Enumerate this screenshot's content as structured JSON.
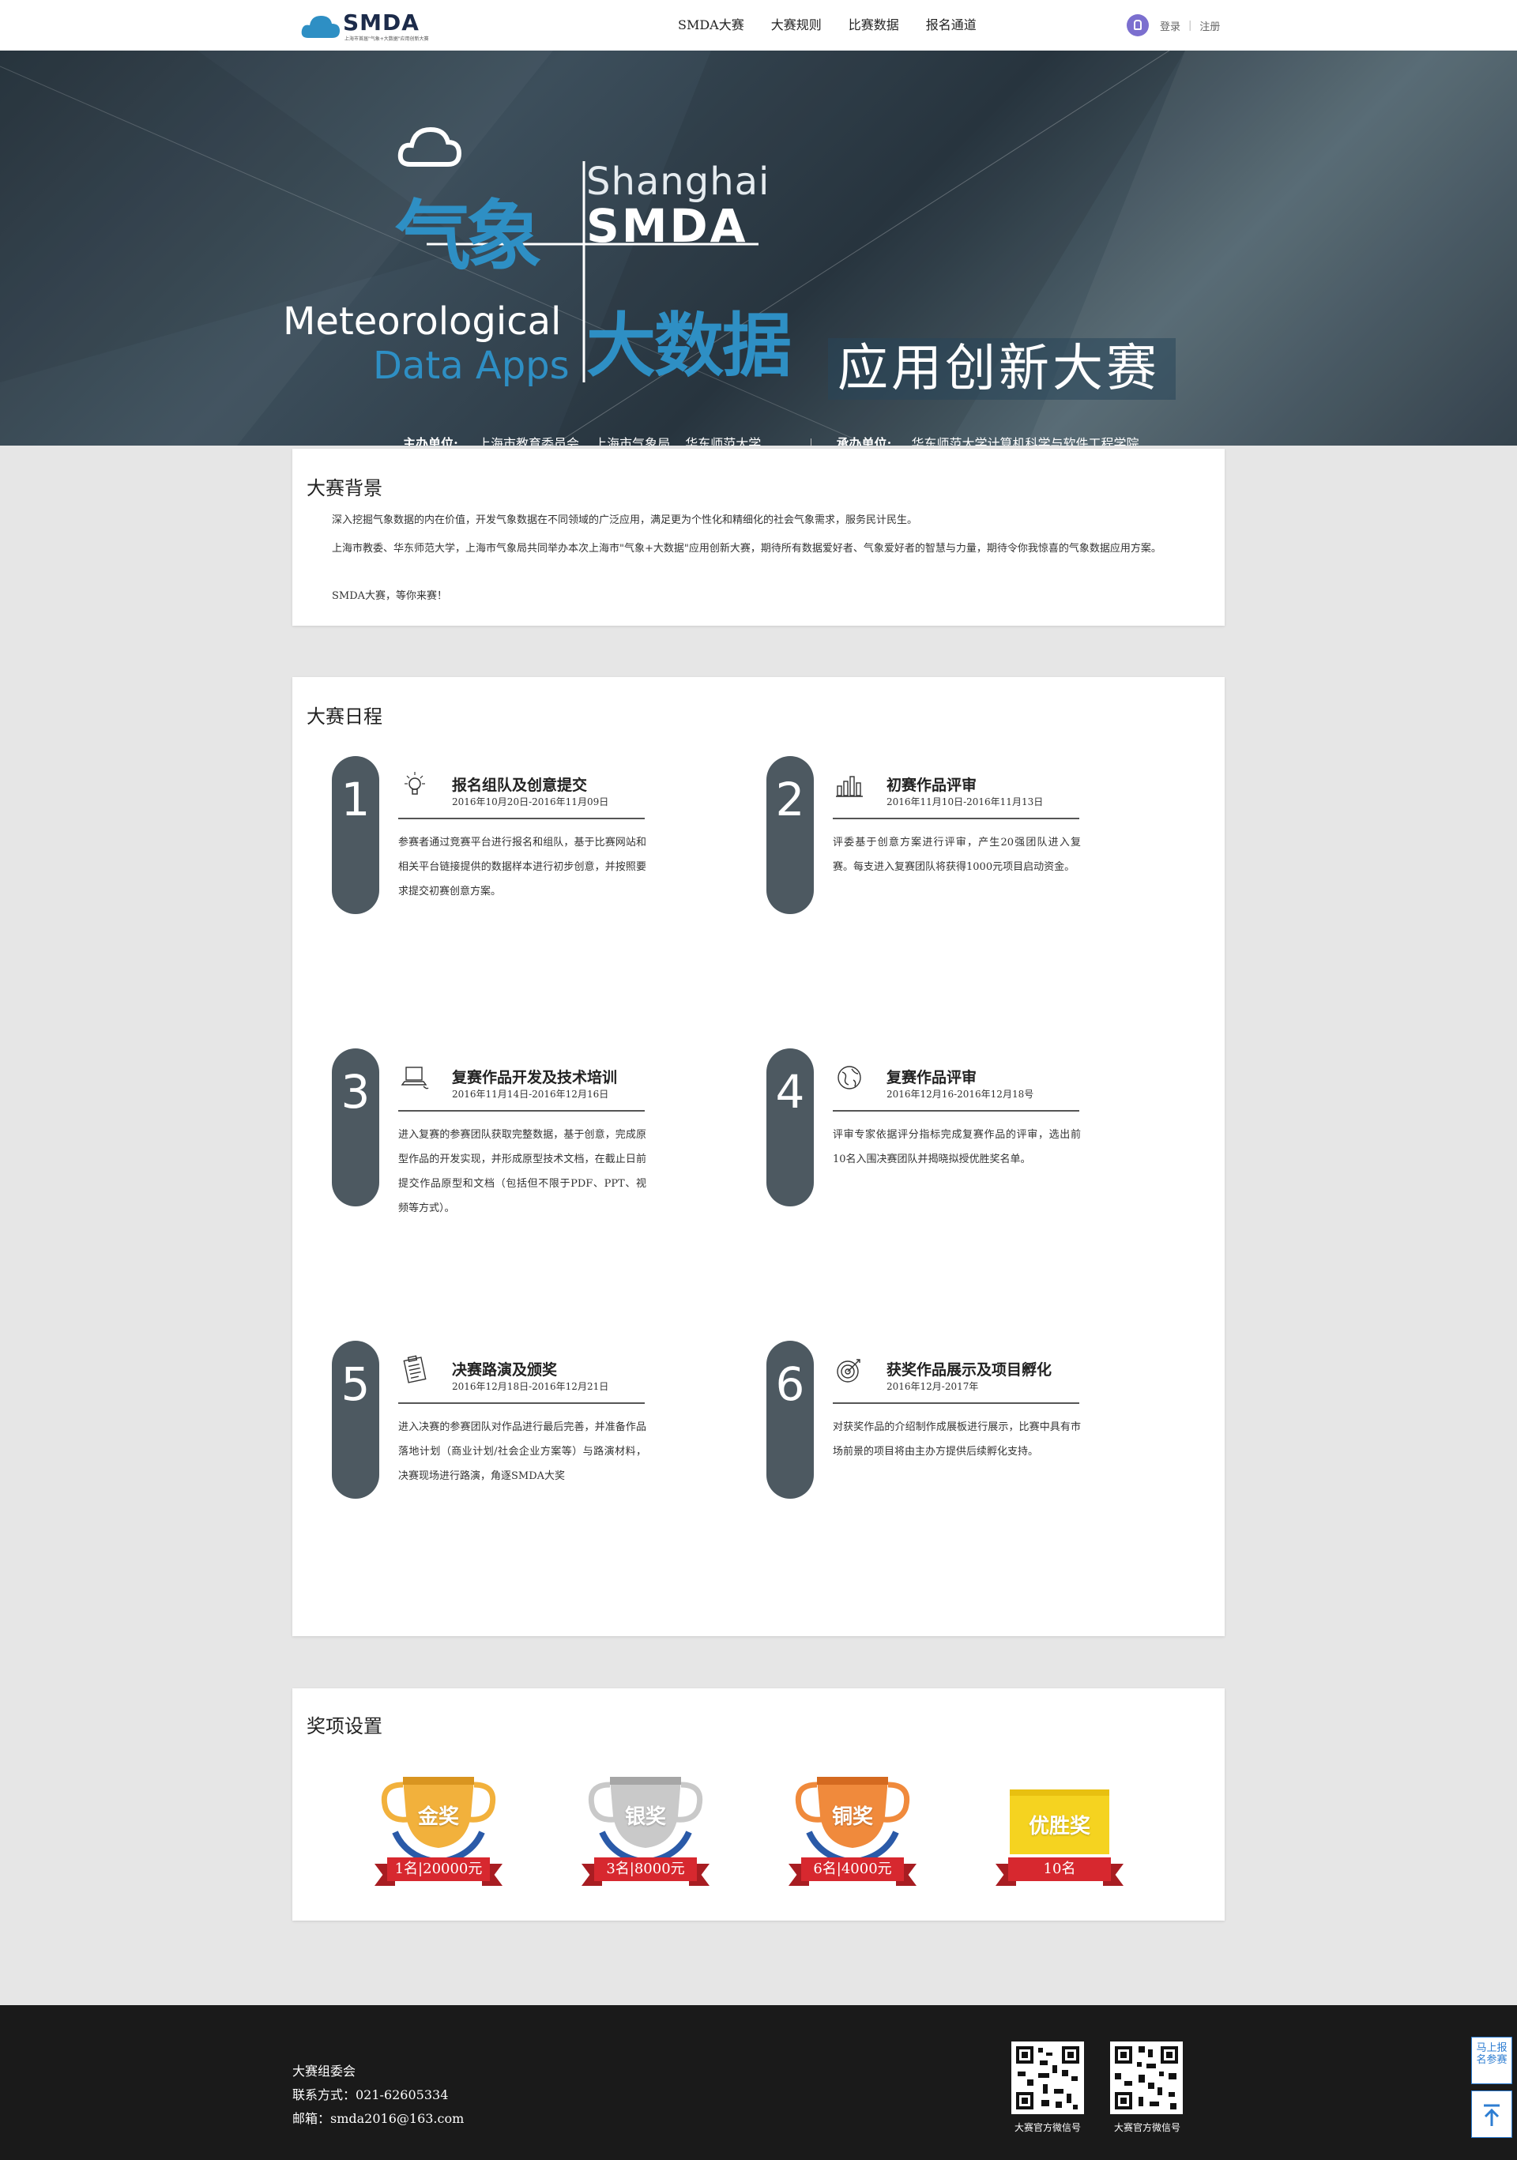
{
  "nav": {
    "logo_text": "SMDA",
    "logo_sub": "上海市首届\"气象+大数据\"应用创新大赛",
    "menu": [
      "SMDA大赛",
      "大赛规则",
      "比赛数据",
      "报名通道"
    ],
    "login": "登录",
    "sep": "|",
    "register": "注册"
  },
  "banner": {
    "shanghai": "Shanghai",
    "smda": "SMDA",
    "qixiang": "气象",
    "meteorological": "Meteorological",
    "data_apps": "Data Apps",
    "dashuju": "大数据",
    "subtitle": "应用创新大赛",
    "host_label": "主办单位:",
    "hosts": [
      "上海市教育委员会",
      "上海市气象局",
      "华东师范大学"
    ],
    "org_label": "承办单位:",
    "organizer": "华东师范大学计算机科学与软件工程学院"
  },
  "background": {
    "title": "大赛背景",
    "paragraphs": [
      "深入挖掘气象数据的内在价值，开发气象数据在不同领域的广泛应用，满足更为个性化和精细化的社会气象需求，服务民计民生。",
      "上海市教委、华东师范大学，上海市气象局共同举办本次上海市\"气象+大数据\"应用创新大赛，期待所有数据爱好者、气象爱好者的智慧与力量，期待令你我惊喜的气象数据应用方案。",
      "SMDA大赛，等你来赛！"
    ]
  },
  "schedule": {
    "title": "大赛日程",
    "steps": [
      {
        "num": "1",
        "icon": "lightbulb-icon",
        "title": "报名组队及创意提交",
        "date": "2016年10月20日-2016年11月09日",
        "desc": "参赛者通过竞赛平台进行报名和组队，基于比赛网站和相关平台链接提供的数据样本进行初步创意，并按照要求提交初赛创意方案。"
      },
      {
        "num": "2",
        "icon": "bar-chart-icon",
        "title": "初赛作品评审",
        "date": "2016年11月10日-2016年11月13日",
        "desc": "评委基于创意方案进行评审，产生20强团队进入复赛。每支进入复赛团队将获得1000元项目启动资金。"
      },
      {
        "num": "3",
        "icon": "laptop-icon",
        "title": "复赛作品开发及技术培训",
        "date": "2016年11月14日-2016年12月16日",
        "desc": "进入复赛的参赛团队获取完整数据，基于创意，完成原型作品的开发实现，并形成原型技术文档，在截止日前提交作品原型和文档（包括但不限于PDF、PPT、视频等方式）。"
      },
      {
        "num": "4",
        "icon": "globe-icon",
        "title": "复赛作品评审",
        "date": "2016年12月16-2016年12月18号",
        "desc": "评审专家依据评分指标完成复赛作品的评审，选出前10名入围决赛团队并揭晓拟授优胜奖名单。"
      },
      {
        "num": "5",
        "icon": "clipboard-icon",
        "title": "决赛路演及颁奖",
        "date": "2016年12月18日-2016年12月21日",
        "desc": "进入决赛的参赛团队对作品进行最后完善，并准备作品落地计划（商业计划/社会企业方案等）与路演材料，决赛现场进行路演，角逐SMDA大奖"
      },
      {
        "num": "6",
        "icon": "target-icon",
        "title": "获奖作品展示及项目孵化",
        "date": "2016年12月-2017年",
        "desc": "对获奖作品的介绍制作成展板进行展示，比赛中具有市场前景的项目将由主办方提供后续孵化支持。"
      }
    ]
  },
  "awards": {
    "title": "奖项设置",
    "items": [
      {
        "name": "金奖",
        "detail": "1名|20000元",
        "color": "#f2b13c"
      },
      {
        "name": "银奖",
        "detail": "3名|8000元",
        "color": "#c9c9c9"
      },
      {
        "name": "铜奖",
        "detail": "6名|4000元",
        "color": "#f08a3c"
      },
      {
        "name": "优胜奖",
        "detail": "10名",
        "color": "#f5d320"
      }
    ]
  },
  "footer": {
    "org": "大赛组委会",
    "contact": "联系方式：021-62605334",
    "email": "邮箱：smda2016@163.com",
    "qr_captions": [
      "大赛官方微信号",
      "大赛官方微信号"
    ]
  },
  "side": {
    "join": "马上报名参赛",
    "top_icon": "back-to-top-icon"
  }
}
